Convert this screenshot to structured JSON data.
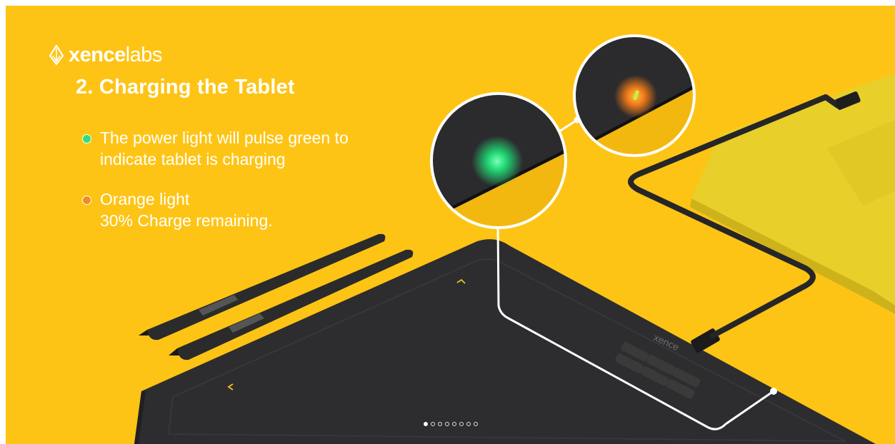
{
  "brand": {
    "logo_bold": "xence",
    "logo_light": "labs",
    "device_label": "xence",
    "logo_icon": "pen-nib-icon"
  },
  "slide": {
    "heading": "2. Charging the Tablet",
    "bullets": [
      {
        "color": "#2ee07a",
        "lines": [
          "The power light will pulse green to",
          "indicate tablet is charging"
        ]
      },
      {
        "color": "#f28b21",
        "lines": [
          "Orange light",
          "30% Charge remaining."
        ]
      }
    ]
  },
  "pagination": {
    "total": 8,
    "current": 1
  },
  "colors": {
    "background": "#fec415",
    "text": "#ffffff",
    "tablet": "#2c2c2e",
    "cable": "#262626"
  }
}
